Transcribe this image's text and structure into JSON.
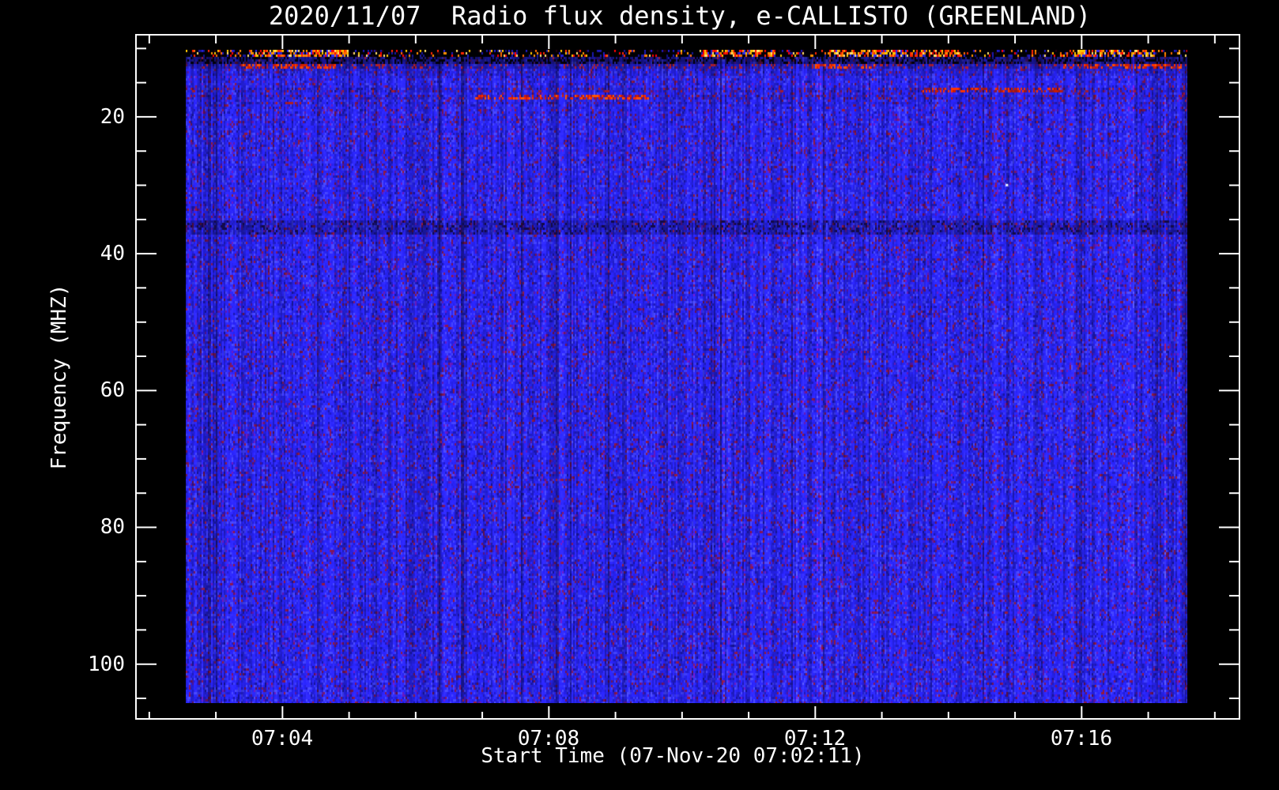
{
  "title": "2020/11/07  Radio flux density, e-CALLISTO (GREENLAND)",
  "x_axis": {
    "label": "Start Time (07-Nov-20 07:02:11)",
    "tick_labels": [
      "07:04",
      "07:08",
      "07:12",
      "07:16"
    ]
  },
  "y_axis": {
    "label": "Frequency (MHZ)",
    "tick_labels": [
      "20",
      "40",
      "60",
      "80",
      "100"
    ]
  },
  "colors": {
    "background": "#000000",
    "frame": "#ffffff",
    "text": "#ffffff",
    "noise_base": "#2622e8",
    "noise_bright": "#4444ff",
    "noise_purple": "#5c16a8",
    "noise_maroon": "#701650",
    "rfi_hot": [
      "#ff2600",
      "#ff6a00",
      "#ffc400",
      "#ff0000",
      "#ff9000",
      "#ffe070"
    ]
  },
  "chart_data": {
    "type": "heatmap",
    "title": "2020/11/07  Radio flux density, e-CALLISTO (GREENLAND)",
    "xlabel": "Start Time (07-Nov-20 07:02:11)",
    "ylabel": "Frequency (MHZ)",
    "x_tick_minutes": [
      4,
      8,
      12,
      16
    ],
    "x_tick_labels": [
      "07:04",
      "07:08",
      "07:12",
      "07:16"
    ],
    "x_minor_step_minutes": 1,
    "x_axis_range_minutes": [
      1.8,
      18.37
    ],
    "data_time_range_minutes": [
      2.55,
      17.59
    ],
    "y_ticks_mhz": [
      20,
      40,
      60,
      80,
      100
    ],
    "y_minor_step_mhz": 5,
    "y_axis_range_mhz": [
      8,
      108
    ],
    "data_freq_range_mhz": [
      10.2,
      105.7
    ],
    "background_description": "quiet-sun blue noise field with vertical striation",
    "features": [
      {
        "kind": "rfi_band_black_with_bursts",
        "freq_mhz": [
          10.2,
          11.3
        ],
        "burst_times_min": [
          [
            3.5,
            5.0
          ],
          [
            10.3,
            11.4
          ],
          [
            12.2,
            14.2
          ],
          [
            15.9,
            17.1
          ]
        ]
      },
      {
        "kind": "dark_band",
        "freq_mhz": [
          11.3,
          12.3
        ]
      },
      {
        "kind": "rfi_line",
        "freq_mhz": [
          12.35,
          13.0
        ],
        "burst_times_min": [
          [
            3.4,
            4.9
          ],
          [
            12.0,
            12.9
          ],
          [
            15.7,
            17.5
          ]
        ]
      },
      {
        "kind": "rfi_line",
        "freq_mhz": [
          15.6,
          16.3
        ],
        "burst_times_min": [
          [
            13.6,
            15.7
          ]
        ]
      },
      {
        "kind": "rfi_line",
        "freq_mhz": [
          16.8,
          17.4
        ],
        "burst_times_min": [
          [
            6.9,
            9.5
          ]
        ]
      },
      {
        "kind": "faint_rfi_line",
        "freq_mhz": [
          17.6,
          18.1
        ],
        "burst_times_min": [
          [
            3.7,
            4.4
          ]
        ]
      },
      {
        "kind": "dark_band",
        "freq_mhz": [
          35.0,
          37.2
        ]
      },
      {
        "kind": "white_speck",
        "time_min": 14.86,
        "freq_mhz": 29.8
      }
    ]
  }
}
